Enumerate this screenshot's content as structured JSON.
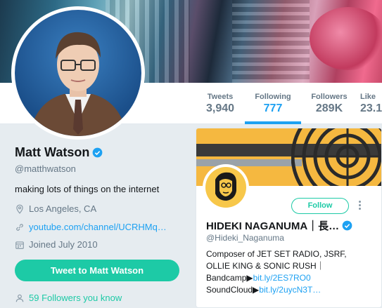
{
  "profile": {
    "name": "Matt Watson",
    "handle": "@matthwatson",
    "bio": "making lots of things on the internet",
    "location": "Los Angeles, CA",
    "website": "youtube.com/channel/UCRHMq…",
    "joined": "Joined July 2010",
    "tweet_to_label": "Tweet to Matt Watson",
    "followers_you_know": "59 Followers you know"
  },
  "nav": {
    "stats": [
      {
        "label": "Tweets",
        "value": "3,940"
      },
      {
        "label": "Following",
        "value": "777"
      },
      {
        "label": "Followers",
        "value": "289K"
      },
      {
        "label": "Like",
        "value": "23.1"
      }
    ],
    "active_index": 1
  },
  "card": {
    "name": "HIDEKI NAGANUMA｜長…",
    "handle": "@Hideki_Naganuma",
    "follow_label": "Follow",
    "bio_line1": "Composer of JET SET RADIO, JSRF,",
    "bio_line2": "OLLIE KING & SONIC RUSH｜",
    "bio_line3_prefix": "Bandcamp▶",
    "bio_line3_link": "bit.ly/2ES7RO0",
    "bio_line4_prefix": "SoundCloud▶",
    "bio_line4_link": "bit.ly/2uycN3T…"
  },
  "colors": {
    "accent": "#1da1f2",
    "theme": "#1dcaa6",
    "background": "#e6ecf0"
  },
  "icons": [
    "location-icon",
    "link-icon",
    "calendar-icon",
    "followers-icon",
    "verified-icon",
    "more-icon"
  ]
}
